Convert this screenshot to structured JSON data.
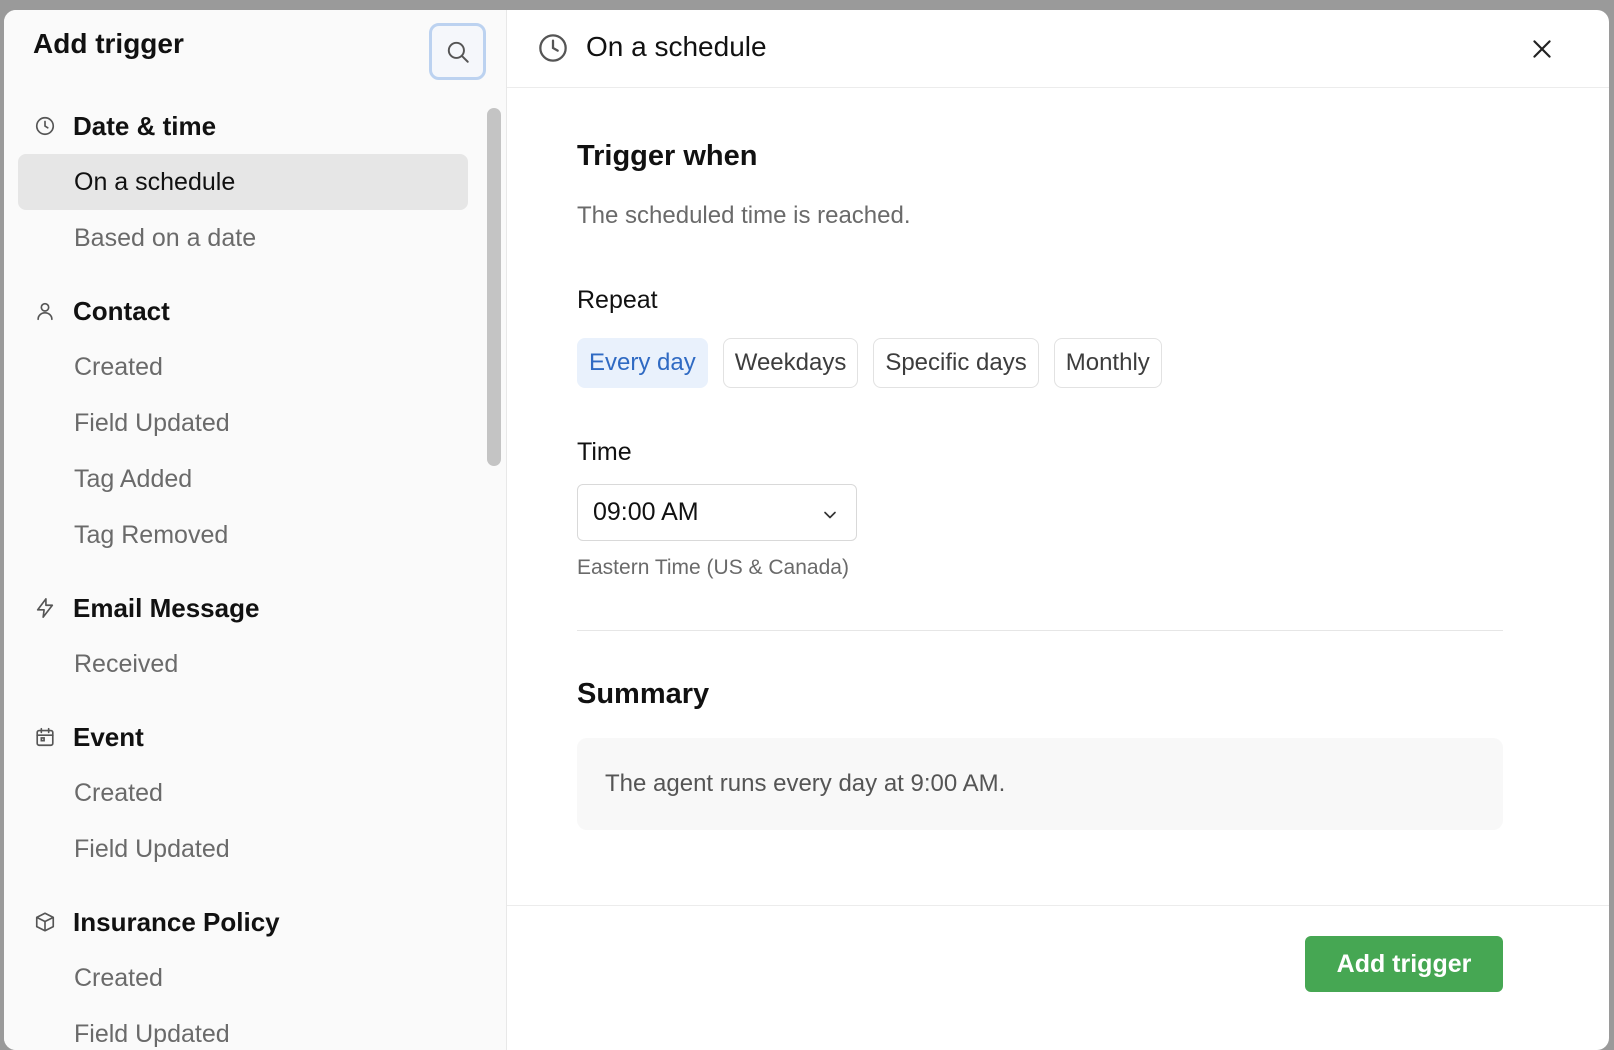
{
  "left": {
    "title": "Add trigger",
    "search_icon": "search-icon",
    "groups": [
      {
        "label": "Date & time",
        "icon": "clock-icon",
        "items": [
          {
            "label": "On a schedule",
            "active": true
          },
          {
            "label": "Based on a date"
          }
        ]
      },
      {
        "label": "Contact",
        "icon": "person-icon",
        "items": [
          {
            "label": "Created"
          },
          {
            "label": "Field Updated"
          },
          {
            "label": "Tag Added"
          },
          {
            "label": "Tag Removed"
          }
        ]
      },
      {
        "label": "Email Message",
        "icon": "bolt-icon",
        "items": [
          {
            "label": "Received"
          }
        ]
      },
      {
        "label": "Event",
        "icon": "calendar-icon",
        "items": [
          {
            "label": "Created"
          },
          {
            "label": "Field Updated"
          }
        ]
      },
      {
        "label": "Insurance Policy",
        "icon": "box-icon",
        "items": [
          {
            "label": "Created"
          },
          {
            "label": "Field Updated"
          }
        ]
      }
    ]
  },
  "right": {
    "header_icon": "clock-icon",
    "title": "On a schedule",
    "close_icon": "close-icon",
    "trigger_when": {
      "title": "Trigger when",
      "description": "The scheduled time is reached."
    },
    "repeat": {
      "label": "Repeat",
      "options": [
        "Every day",
        "Weekdays",
        "Specific days",
        "Monthly"
      ],
      "selected": "Every day"
    },
    "time": {
      "label": "Time",
      "value": "09:00 AM",
      "timezone": "Eastern Time (US & Canada)"
    },
    "summary": {
      "title": "Summary",
      "text": "The agent runs every day at 9:00 AM."
    },
    "add_button_label": "Add trigger"
  },
  "colors": {
    "accent_green": "#46a753",
    "selected_chip_bg": "#e9f1fc",
    "selected_chip_text": "#2f6ac3"
  }
}
